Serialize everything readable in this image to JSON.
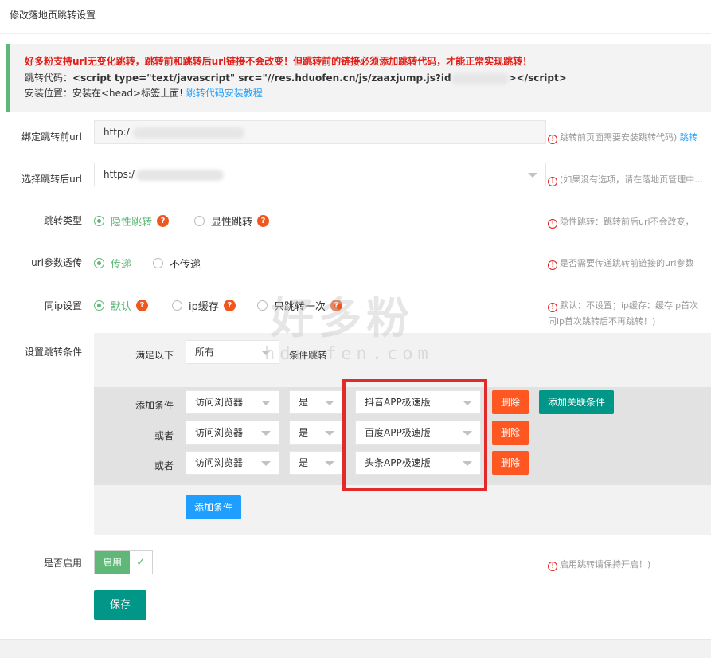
{
  "page_title": "修改落地页跳转设置",
  "notice": {
    "line1": "好多粉支持url无变化跳转，跳转前和跳转后url链接不会改变！但跳转前的链接必须添加跳转代码，才能正常实现跳转！",
    "line2_label": "跳转代码：",
    "line2_code_a": "<script type=\"text/javascript\" src=\"//res.hduofen.cn/js/zaaxjump.js?id",
    "line2_code_b": "></script>",
    "line3_label": "安装位置：安装在<head>标签上面! ",
    "line3_link": "跳转代码安装教程"
  },
  "form": {
    "bind_url_label": "绑定跳转前url",
    "bind_url_value": "http:/",
    "bind_url_hint": "跳转前页面需要安装跳转代码)",
    "bind_url_hint_link": "跳转",
    "target_url_label": "选择跳转后url",
    "target_url_value": "https:/",
    "target_url_hint": "(如果没有选项，请在落地页管理中…",
    "jump_type_label": "跳转类型",
    "jump_type_options": [
      "隐性跳转",
      "显性跳转"
    ],
    "jump_type_hint": "隐性跳转：跳转前后url不会改变，",
    "url_param_label": "url参数透传",
    "url_param_options": [
      "传递",
      "不传递"
    ],
    "url_param_hint": "是否需要传递跳转前链接的url参数",
    "same_ip_label": "同ip设置",
    "same_ip_options": [
      "默认",
      "ip缓存",
      "只跳转一次"
    ],
    "same_ip_hint_1": "默认：不设置；ip缓存：缓存ip首次",
    "same_ip_hint_2": "同ip首次跳转后不再跳转！)",
    "conditions_label": "设置跳转条件",
    "satisfy_label": "满足以下",
    "satisfy_value": "所有",
    "satisfy_suffix": "条件跳转",
    "conditions": [
      {
        "prefix": "添加条件",
        "field": "访问浏览器",
        "op": "是",
        "value": "抖音APP极速版"
      },
      {
        "prefix": "或者",
        "field": "访问浏览器",
        "op": "是",
        "value": "百度APP极速版"
      },
      {
        "prefix": "或者",
        "field": "访问浏览器",
        "op": "是",
        "value": "头条APP极速版"
      }
    ],
    "delete_label": "删除",
    "add_related_label": "添加关联条件",
    "add_condition_label": "添加条件",
    "enable_label": "是否启用",
    "enable_switch_text": "启用",
    "enable_hint": "启用跳转请保持开启！)",
    "save_label": "保存"
  },
  "watermark": {
    "cn": "好多粉",
    "en": "hduofen.com"
  },
  "colors": {
    "accent_green": "#5fb878",
    "teal": "#009688",
    "danger": "#ff5722",
    "link_blue": "#1e9fff",
    "notice_red": "#e0201a",
    "highlight_red": "#e32a2a"
  }
}
